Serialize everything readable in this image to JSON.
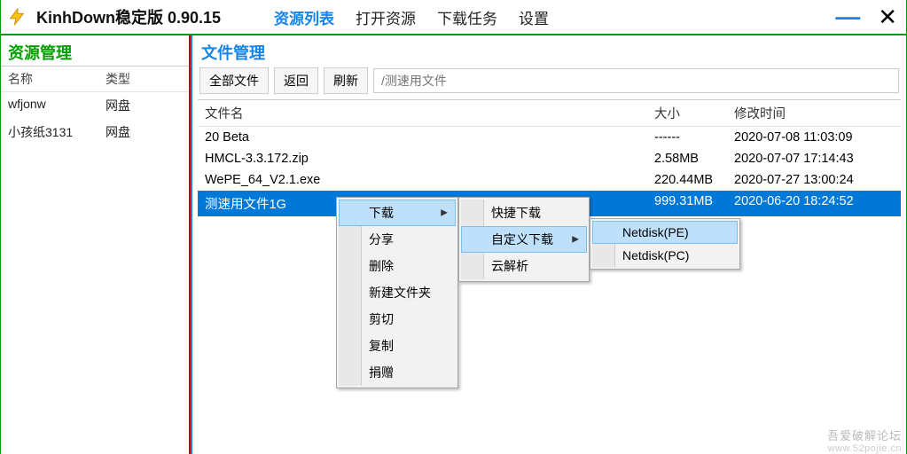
{
  "app": {
    "title": "KinhDown稳定版 0.90.15"
  },
  "topmenu": {
    "items": [
      "资源列表",
      "打开资源",
      "下载任务",
      "设置"
    ],
    "active": 0
  },
  "sidebar": {
    "title": "资源管理",
    "cols": [
      "名称",
      "类型"
    ],
    "rows": [
      {
        "name": "wfjonw",
        "type": "网盘"
      },
      {
        "name": "小孩纸3131",
        "type": "网盘"
      }
    ]
  },
  "main": {
    "title": "文件管理",
    "toolbar": {
      "all": "全部文件",
      "back": "返回",
      "refresh": "刷新"
    },
    "path_placeholder": "/测速用文件",
    "cols": {
      "name": "文件名",
      "size": "大小",
      "date": "修改时间"
    },
    "rows": [
      {
        "name": "20 Beta",
        "size": "------",
        "date": "2020-07-08 11:03:09",
        "selected": false
      },
      {
        "name": "HMCL-3.3.172.zip",
        "size": "2.58MB",
        "date": "2020-07-07 17:14:43",
        "selected": false
      },
      {
        "name": "WePE_64_V2.1.exe",
        "size": "220.44MB",
        "date": "2020-07-27 13:00:24",
        "selected": false
      },
      {
        "name": "测速用文件1G",
        "size": "999.31MB",
        "date": "2020-06-20 18:24:52",
        "selected": true
      }
    ]
  },
  "ctx1": {
    "items": [
      {
        "label": "下载",
        "sub": true,
        "hl": true
      },
      {
        "label": "分享"
      },
      {
        "label": "删除"
      },
      {
        "label": "新建文件夹"
      },
      {
        "label": "剪切"
      },
      {
        "label": "复制"
      },
      {
        "label": "捐赠"
      }
    ]
  },
  "ctx2": {
    "items": [
      {
        "label": "快捷下载"
      },
      {
        "label": "自定义下载",
        "sub": true,
        "hl": true
      },
      {
        "label": "云解析"
      }
    ]
  },
  "ctx3": {
    "items": [
      {
        "label": "Netdisk(PE)",
        "hl": true
      },
      {
        "label": "Netdisk(PC)"
      }
    ]
  },
  "watermark": {
    "a": "吾爱破解论坛",
    "b": "www.52pojie.cn"
  }
}
